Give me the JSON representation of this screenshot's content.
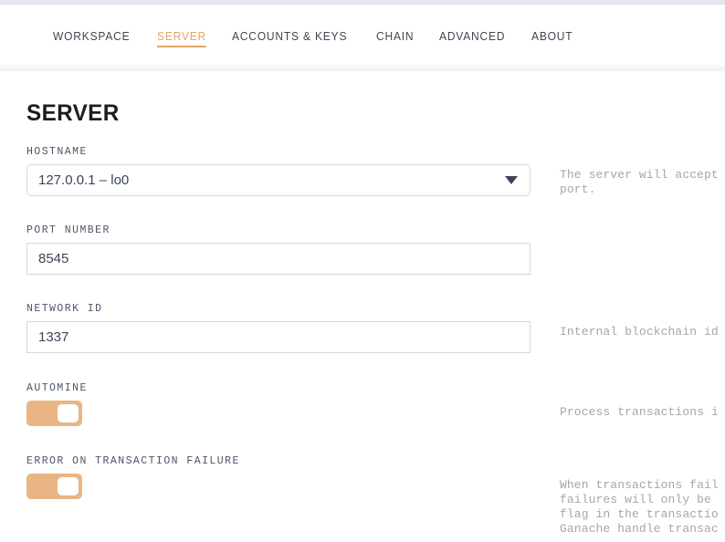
{
  "window": {
    "titlebar_color": "#e8e6ef"
  },
  "theme": {
    "accent": "#e3a463",
    "toggle_on": "#eab585",
    "label_color": "#4c5768",
    "description_color": "#a6a6a6",
    "input_border": "#d6d8dc",
    "heading_color": "#1d1d1d"
  },
  "tabs": [
    {
      "id": "workspace",
      "label": "WORKSPACE",
      "active": false
    },
    {
      "id": "server",
      "label": "SERVER",
      "active": true
    },
    {
      "id": "accounts-keys",
      "label": "ACCOUNTS & KEYS",
      "active": false
    },
    {
      "id": "chain",
      "label": "CHAIN",
      "active": false
    },
    {
      "id": "advanced",
      "label": "ADVANCED",
      "active": false
    },
    {
      "id": "about",
      "label": "ABOUT",
      "active": false
    }
  ],
  "page": {
    "title": "SERVER"
  },
  "fields": {
    "hostname": {
      "label": "HOSTNAME",
      "value": "127.0.0.1 – lo0",
      "caret_icon": "chevron-down-icon",
      "description_lines": [
        "The server will accept",
        "port."
      ]
    },
    "port_number": {
      "label": "PORT NUMBER",
      "value": "8545",
      "description_lines": []
    },
    "network_id": {
      "label": "NETWORK ID",
      "value": "1337",
      "description_lines": [
        "Internal blockchain id"
      ]
    },
    "automine": {
      "label": "AUTOMINE",
      "state": "on",
      "description_lines": [
        "Process transactions i"
      ]
    },
    "error_on_transaction_failure": {
      "label": "ERROR ON TRANSACTION FAILURE",
      "state": "on",
      "description_lines": [
        "When transactions fail",
        "failures will only be",
        "flag in the transactio",
        "Ganache handle transac"
      ]
    }
  }
}
